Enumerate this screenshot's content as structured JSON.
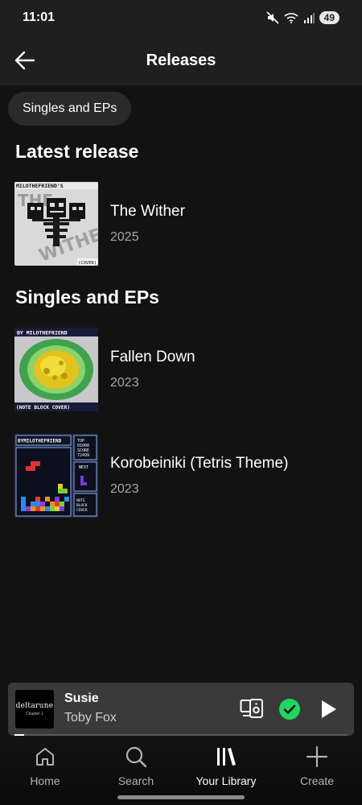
{
  "status": {
    "time": "11:01",
    "battery": "49"
  },
  "header": {
    "title": "Releases"
  },
  "filter_chip": "Singles and EPs",
  "sections": {
    "latest_heading": "Latest release",
    "singles_heading": "Singles and EPs"
  },
  "latest": {
    "title": "The Wither",
    "year": "2025"
  },
  "singles": [
    {
      "title": "Fallen Down",
      "year": "2023"
    },
    {
      "title": "Korobeiniki (Tetris Theme)",
      "year": "2023"
    }
  ],
  "player": {
    "title": "Susie",
    "artist": "Toby Fox",
    "cover_title": "deltarune",
    "cover_subtitle": "Chapter 1",
    "progress": 0.03
  },
  "nav": {
    "home": "Home",
    "search": "Search",
    "library": "Your Library",
    "create": "Create"
  },
  "covers": {
    "wither": {
      "top": "MILOTHEFRIEND'S",
      "bottom": "(COVER)"
    },
    "fallen": {
      "top": "BY MILOTHEFRIEND",
      "bottom": "(NOTE BLOCK COVER)"
    },
    "tetris": {
      "top": "BYMILOTHEFRIEND",
      "top_label": "TOP",
      "top_value": "01000",
      "score_label": "SCORE",
      "score_value": "72499",
      "next_label": "NEXT",
      "side_note": "NOTE BLOCK COVER"
    }
  },
  "colors": {
    "accent": "#1ed760",
    "background": "#121212",
    "surface": "#1f1f1f"
  }
}
